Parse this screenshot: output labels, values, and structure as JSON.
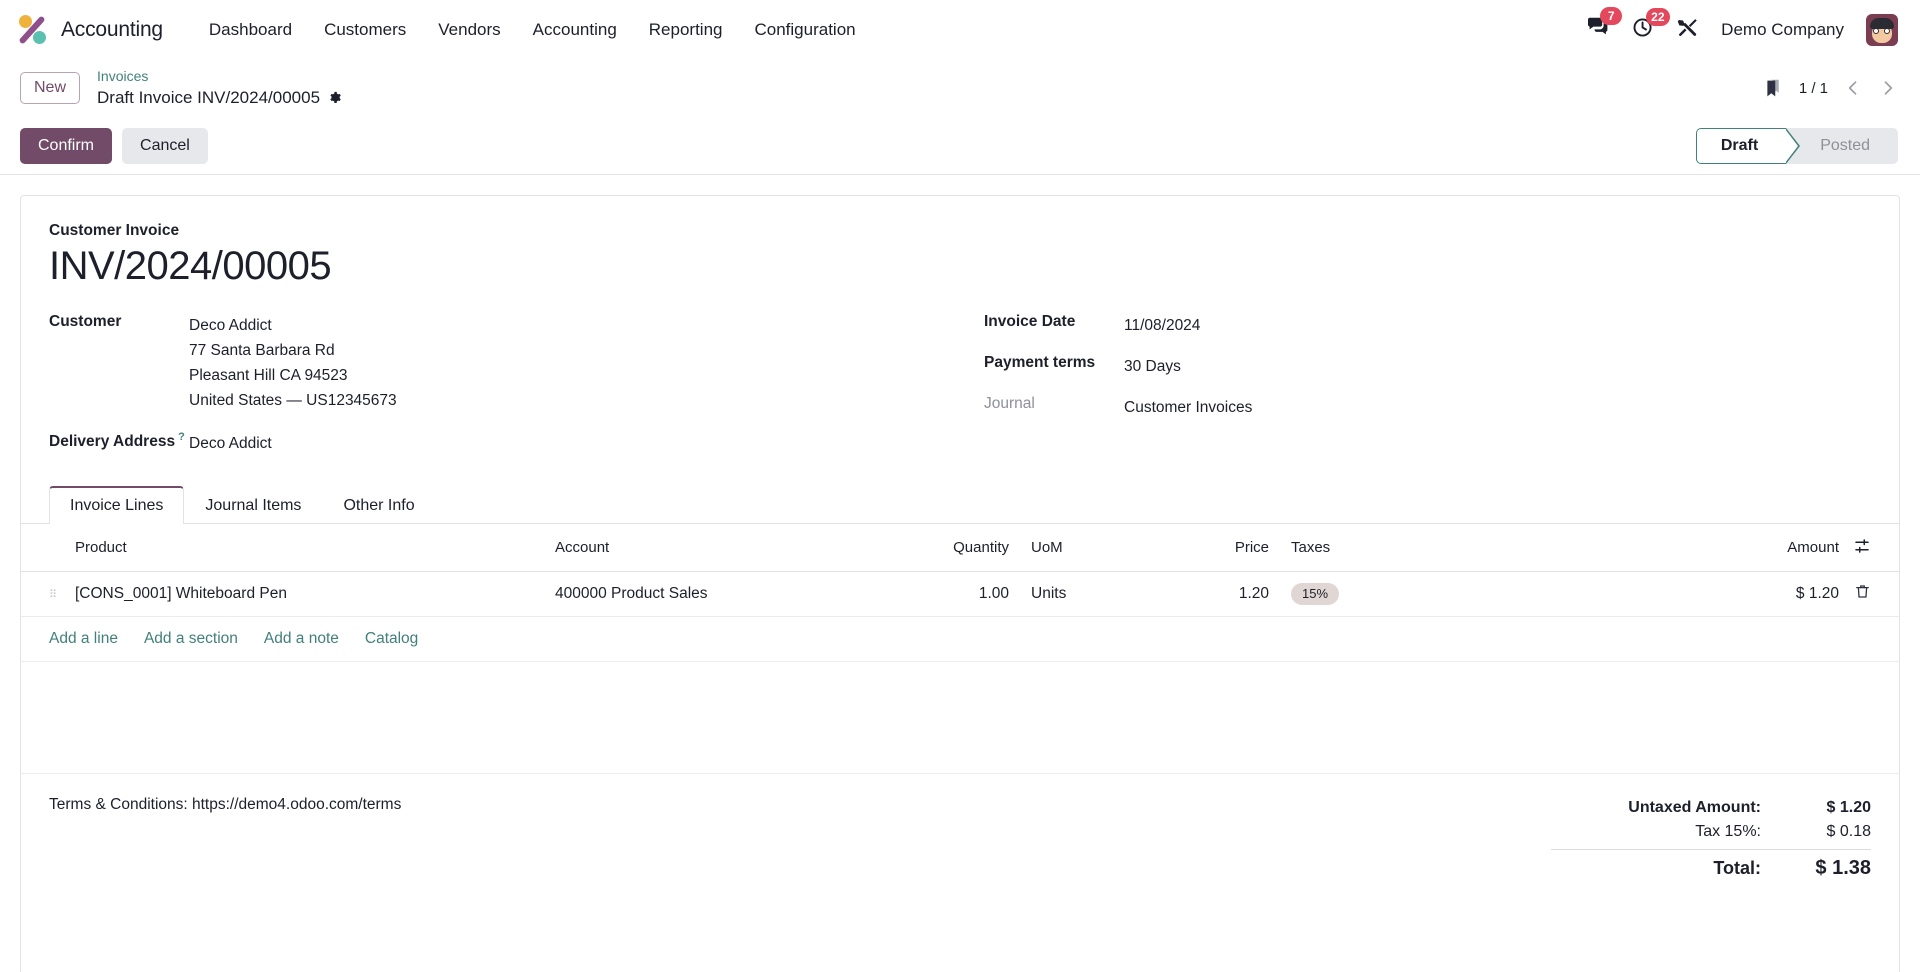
{
  "navbar": {
    "logo_icon": "odoo-logo-icon",
    "brand": "Accounting",
    "menu": [
      {
        "label": "Dashboard"
      },
      {
        "label": "Customers"
      },
      {
        "label": "Vendors"
      },
      {
        "label": "Accounting"
      },
      {
        "label": "Reporting"
      },
      {
        "label": "Configuration"
      }
    ],
    "messages": {
      "icon": "messages-icon",
      "count": "7"
    },
    "activities": {
      "icon": "clock-icon",
      "count": "22"
    },
    "debug": {
      "icon": "tools-icon"
    },
    "company": "Demo Company",
    "avatar_icon": "user-avatar"
  },
  "control_panel": {
    "new_button": "New",
    "breadcrumb_parent": "Invoices",
    "breadcrumb_current": "Draft Invoice INV/2024/00005",
    "settings_icon": "gear-icon",
    "bookmark_icon": "bookmark-icon",
    "pager": "1 / 1",
    "prev_icon": "chevron-left-icon",
    "next_icon": "chevron-right-icon",
    "confirm_button": "Confirm",
    "cancel_button": "Cancel",
    "status": [
      {
        "label": "Draft",
        "active": true
      },
      {
        "label": "Posted",
        "active": false
      }
    ]
  },
  "form": {
    "doc_type": "Customer Invoice",
    "doc_number": "INV/2024/00005",
    "left_fields": {
      "customer_label": "Customer",
      "customer_name": "Deco Addict",
      "customer_address": [
        "77 Santa Barbara Rd",
        "Pleasant Hill CA 94523",
        "United States — US12345673"
      ],
      "delivery_label": "Delivery Address",
      "delivery_help": "?",
      "delivery_value": "Deco Addict"
    },
    "right_fields": [
      {
        "label": "Invoice Date",
        "value": "11/08/2024",
        "muted": false
      },
      {
        "label": "Payment terms",
        "value": "30 Days",
        "muted": false
      },
      {
        "label": "Journal",
        "value": "Customer Invoices",
        "muted": true
      }
    ]
  },
  "notebook": {
    "tabs": [
      {
        "label": "Invoice Lines",
        "active": true
      },
      {
        "label": "Journal Items",
        "active": false
      },
      {
        "label": "Other Info",
        "active": false
      }
    ]
  },
  "lines": {
    "columns": {
      "product": "Product",
      "account": "Account",
      "quantity": "Quantity",
      "uom": "UoM",
      "price": "Price",
      "taxes": "Taxes",
      "amount": "Amount",
      "optional_cols_icon": "column-options-icon"
    },
    "rows": [
      {
        "handle_icon": "drag-handle-icon",
        "product": "[CONS_0001] Whiteboard Pen",
        "account": "400000 Product Sales",
        "quantity": "1.00",
        "uom": "Units",
        "price": "1.20",
        "tax_badge": "15%",
        "amount": "$ 1.20",
        "delete_icon": "trash-icon"
      }
    ],
    "add_links": [
      {
        "label": "Add a line"
      },
      {
        "label": "Add a section"
      },
      {
        "label": "Add a note"
      },
      {
        "label": "Catalog"
      }
    ]
  },
  "footer": {
    "terms": "Terms & Conditions: https://demo4.odoo.com/terms",
    "totals": [
      {
        "label": "Untaxed Amount:",
        "value": "$ 1.20",
        "bold": true
      },
      {
        "label": "Tax 15%:",
        "value": "$ 0.18",
        "bold": false
      },
      {
        "label": "Total:",
        "value": "$ 1.38",
        "grand": true
      }
    ]
  },
  "colors": {
    "primary": "#714b67",
    "accent_teal": "#41807c",
    "badge_red": "#e4485d",
    "tax_badge_bg": "#e0d7d4"
  }
}
